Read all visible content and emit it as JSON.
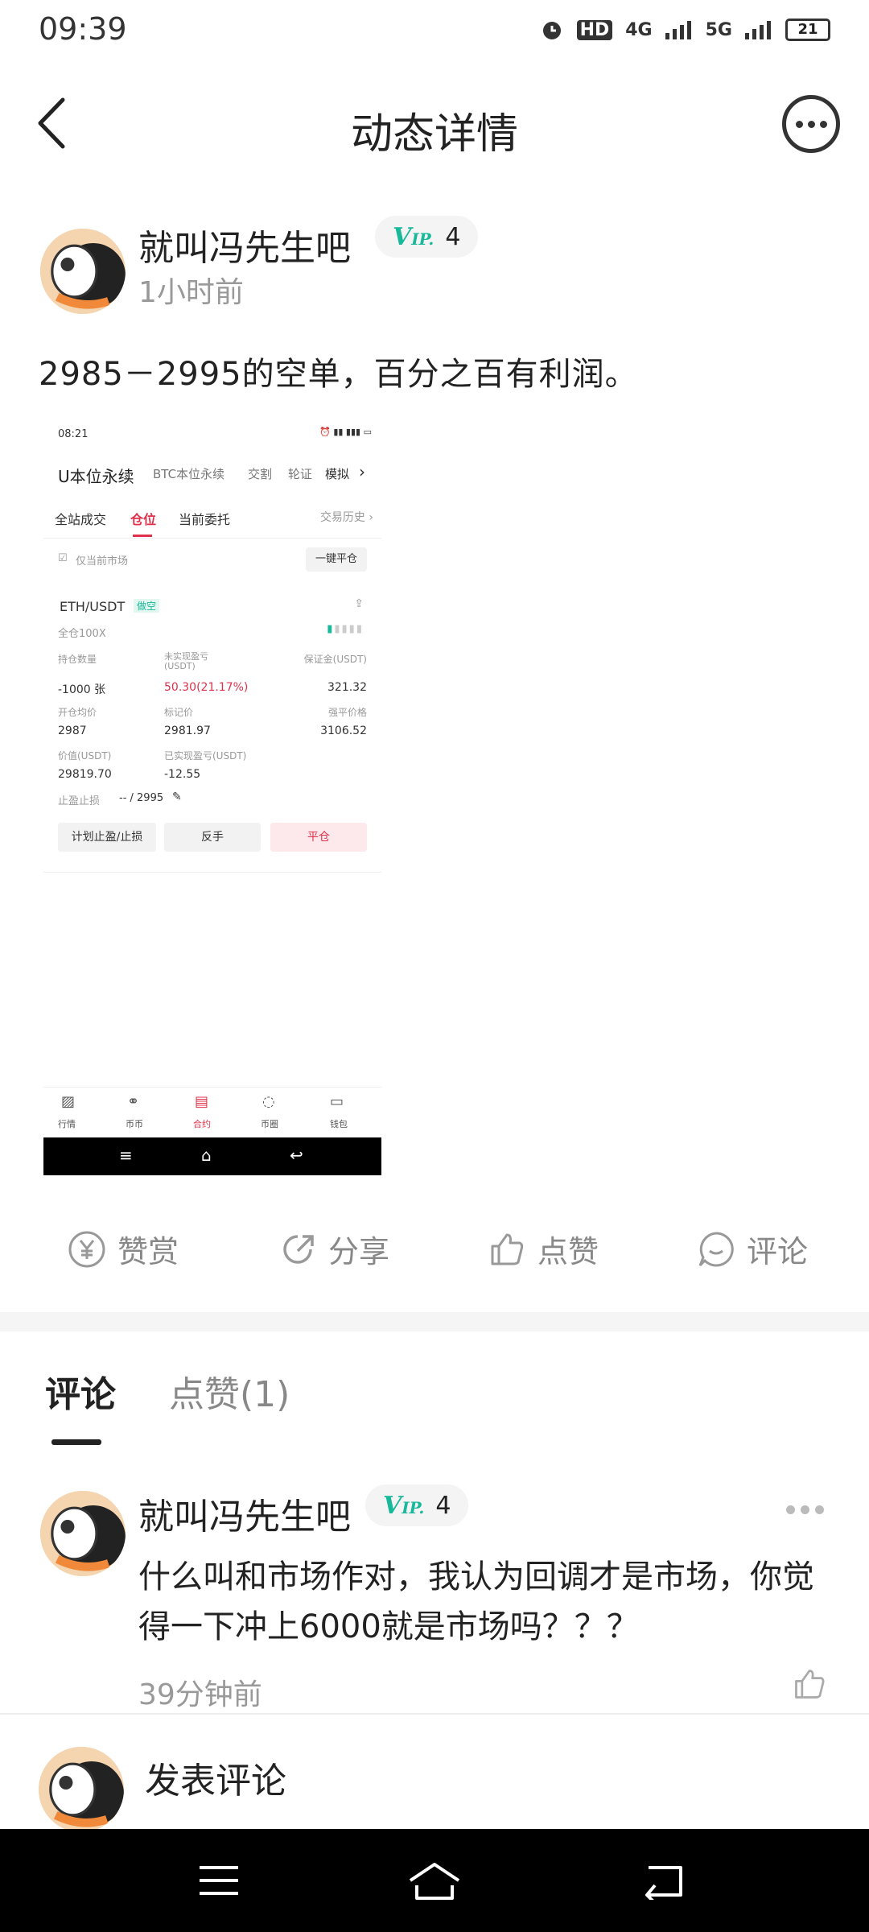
{
  "status_bar": {
    "time": "09:39",
    "hd": "HD",
    "net1": "4G",
    "net2": "5G",
    "battery": "21"
  },
  "header": {
    "title": "动态详情"
  },
  "post": {
    "author": "就叫冯先生吧",
    "vip_level": "4",
    "time": "1小时前",
    "text": "2985－2995的空单，百分之百有利润。"
  },
  "screenshot": {
    "time": "08:21",
    "tabs": [
      "U本位永续",
      "BTC本位永续",
      "交割",
      "轮证",
      "模拟"
    ],
    "subtabs": [
      "全站成交",
      "仓位",
      "当前委托"
    ],
    "history": "交易历史 ›",
    "filter": "仅当前市场",
    "close_all": "一键平仓",
    "pair": "ETH/USDT",
    "direction": "做空",
    "leverage": "全仓100X",
    "labels": {
      "qty": "持仓数量",
      "pnl": "未实现盈亏\n(USDT)",
      "margin": "保证金(USDT)",
      "entry": "开仓均价",
      "mark": "标记价",
      "liq": "强平价格",
      "value": "价值(USDT)",
      "realized": "已实现盈亏(USDT)",
      "tpsl": "止盈止损"
    },
    "values": {
      "qty": "-1000 张",
      "pnl": "50.30(21.17%)",
      "margin": "321.32",
      "entry": "2987",
      "mark": "2981.97",
      "liq": "3106.52",
      "value": "29819.70",
      "realized": "-12.55",
      "tpsl": "-- / 2995"
    },
    "buttons": [
      "计划止盈/止损",
      "反手",
      "平仓"
    ],
    "bottom_tabs": [
      "行情",
      "币币",
      "合约",
      "币圈",
      "钱包"
    ]
  },
  "actions": [
    "赞赏",
    "分享",
    "点赞",
    "评论"
  ],
  "comment_tabs": {
    "comments": "评论",
    "likes": "点赞(1)"
  },
  "comment": {
    "author": "就叫冯先生吧",
    "vip_level": "4",
    "text": "什么叫和市场作对，我认为回调才是市场，你觉得一下冲上6000就是市场吗？？？",
    "time": "39分钟前"
  },
  "input": {
    "placeholder": "发表评论"
  },
  "colors": {
    "accent_red": "#e0314b",
    "vip_green": "#18b89a",
    "text_dark": "#222222",
    "text_gray": "#999999"
  }
}
